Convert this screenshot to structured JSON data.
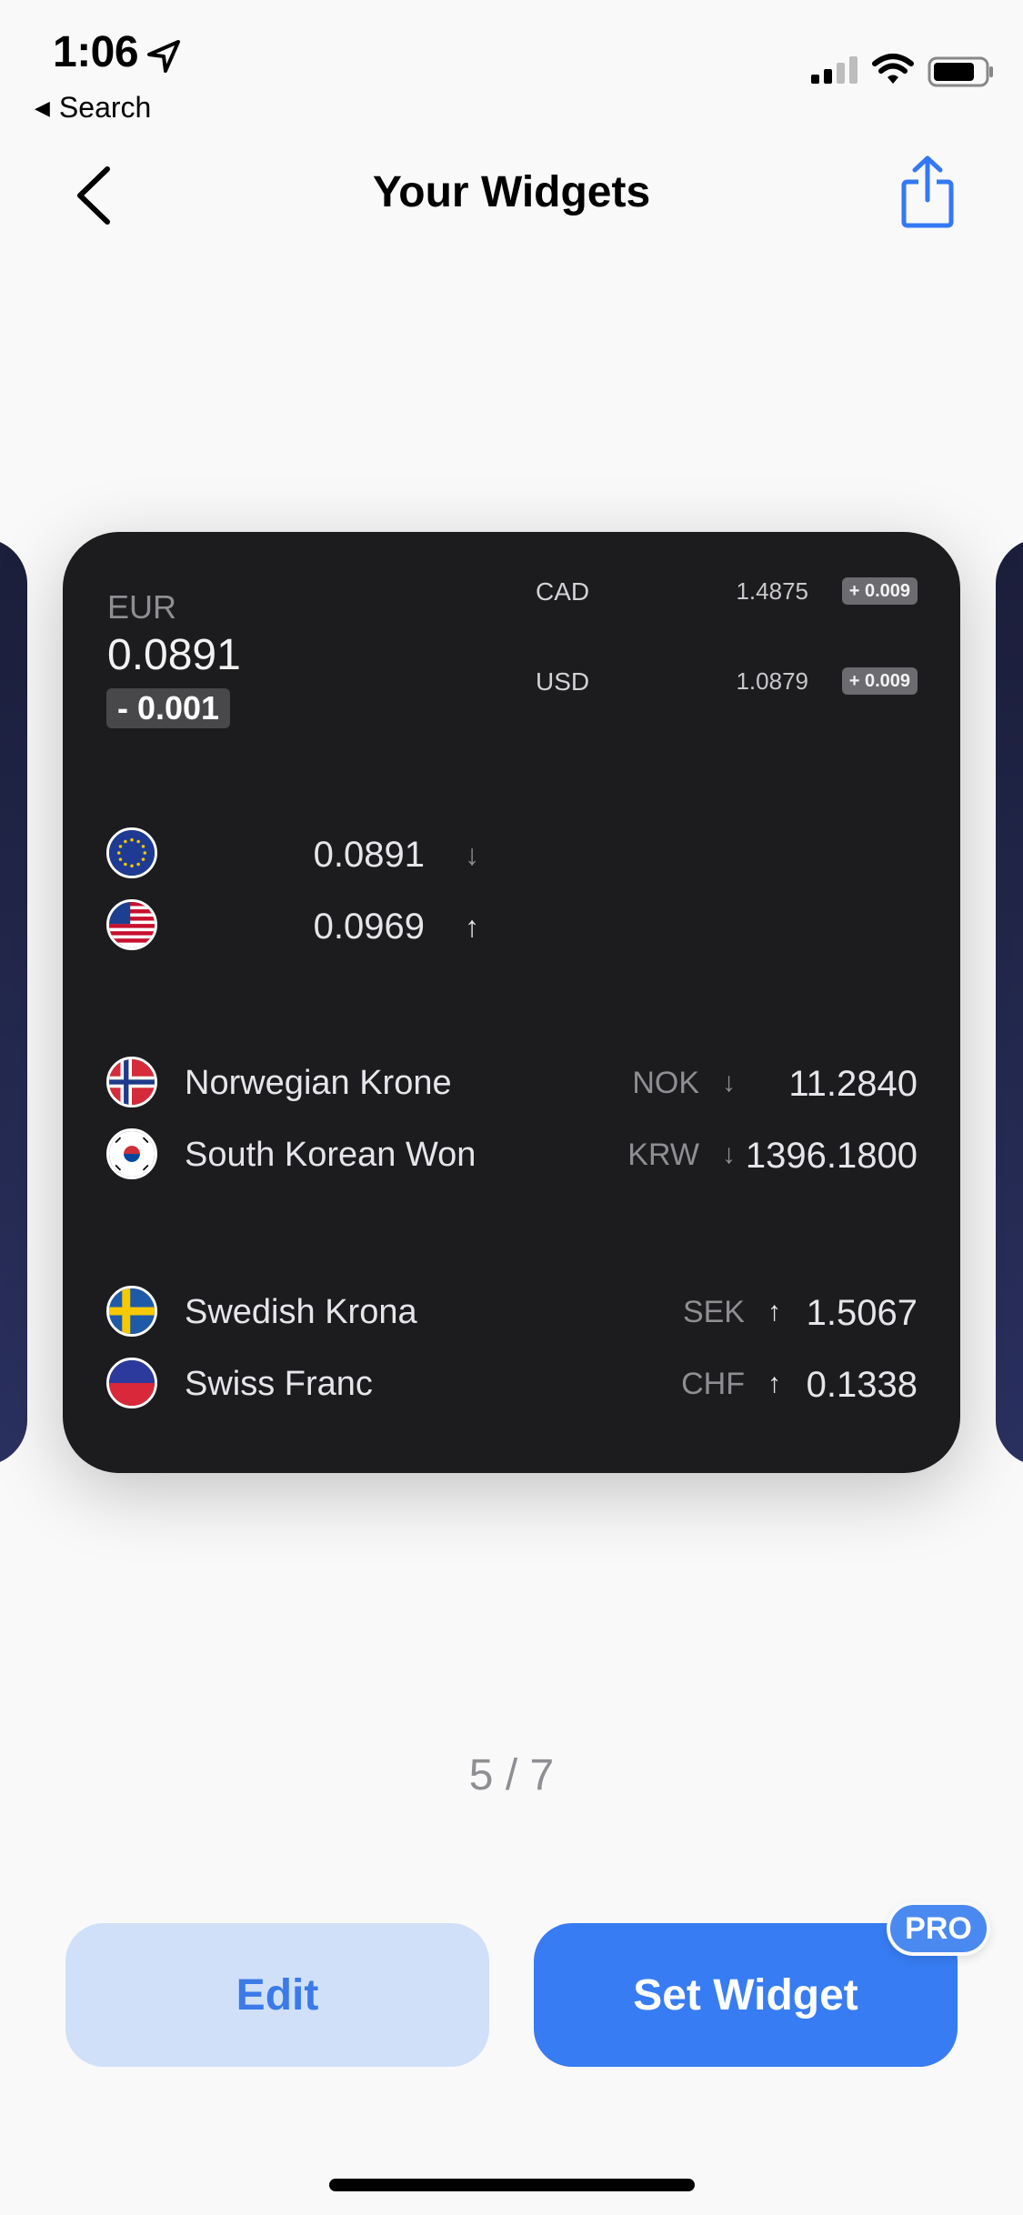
{
  "status_bar": {
    "time": "1:06",
    "back_app": "Search",
    "icons": [
      "location-arrow-icon",
      "signal-icon",
      "wifi-icon",
      "battery-icon"
    ]
  },
  "nav": {
    "title": "Your Widgets",
    "back_icon": "chevron-left-icon",
    "share_icon": "share-icon",
    "accent": "#3478f6"
  },
  "widget": {
    "background": "#1c1c1e",
    "base": {
      "code": "EUR",
      "value": "0.0891",
      "change": "- 0.001"
    },
    "mini_rates": [
      {
        "code": "CAD",
        "value": "1.4875",
        "change": "+ 0.009"
      },
      {
        "code": "USD",
        "value": "1.0879",
        "change": "+ 0.009"
      }
    ],
    "favorites": [
      {
        "flag": "eu-flag-icon",
        "rate": "0.0891",
        "direction": "down"
      },
      {
        "flag": "us-flag-icon",
        "rate": "0.0969",
        "direction": "up"
      }
    ],
    "group_1": [
      {
        "flag": "norway-flag-icon",
        "name": "Norwegian Krone",
        "code": "NOK",
        "direction": "down",
        "rate": "11.2840"
      },
      {
        "flag": "south-korea-flag-icon",
        "name": "South Korean Won",
        "code": "KRW",
        "direction": "down",
        "rate": "1396.1800"
      }
    ],
    "group_2": [
      {
        "flag": "sweden-flag-icon",
        "name": "Swedish Krona",
        "code": "SEK",
        "direction": "up",
        "rate": "1.5067"
      },
      {
        "flag": "switzerland-flag-icon",
        "name": "Swiss Franc",
        "code": "CHF",
        "direction": "up",
        "rate": "0.1338"
      }
    ]
  },
  "pager": {
    "text": "5 / 7"
  },
  "buttons": {
    "edit": "Edit",
    "set_widget": "Set Widget",
    "pro_badge": "PRO"
  },
  "arrows": {
    "up": "↑",
    "down": "↓"
  }
}
